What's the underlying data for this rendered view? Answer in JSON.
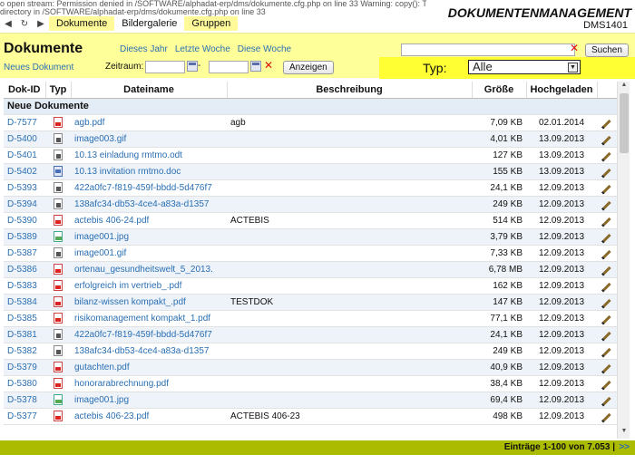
{
  "warning": {
    "line1": "o open stream: Permission denied in /SOFTWARE/alphadat-erp/dms/dokumente.cfg.php on line 33 Warning: copy(): The first argument to copy() function cannot be a",
    "line2": "directory in /SOFTWARE/alphadat-erp/dms/dokumente.cfg.php on line 33"
  },
  "app": {
    "title": "DOKUMENTENMANAGEMENT",
    "subtitle": "DMS1401"
  },
  "nav": {
    "back_icon": "arrow-left-icon",
    "reload_icon": "reload-icon",
    "forward_icon": "arrow-right-icon",
    "items": [
      "Dokumente",
      "Bildergalerie",
      "Gruppen"
    ]
  },
  "toolbar": {
    "title": "Dokumente",
    "new_doc": "Neues Dokument",
    "links": [
      "Dieses Jahr",
      "Letzte Woche",
      "Diese Woche"
    ],
    "range_label": "Zeitraum:",
    "range_sep": "-",
    "show_button": "Anzeigen",
    "search_value": "",
    "search_button": "Suchen",
    "type_label": "Typ:",
    "type_value": "Alle"
  },
  "table": {
    "headers": [
      "Dok-ID",
      "Typ",
      "Dateiname",
      "Beschreibung",
      "Größe",
      "Hochgeladen",
      ""
    ],
    "group": "Neue Dokumente",
    "rows": [
      {
        "id": "D-7577",
        "type": "pdf",
        "name": "agb.pdf",
        "desc": "agb",
        "size": "7,09 KB",
        "date": "02.01.2014"
      },
      {
        "id": "D-5400",
        "type": "gif",
        "name": "image003.gif",
        "desc": "",
        "size": "4,01 KB",
        "date": "13.09.2013"
      },
      {
        "id": "D-5401",
        "type": "odt",
        "name": "10.13 einladung rmtmo.odt",
        "desc": "",
        "size": "127 KB",
        "date": "13.09.2013"
      },
      {
        "id": "D-5402",
        "type": "doc",
        "name": "10.13 invitation rmtmo.doc",
        "desc": "",
        "size": "155 KB",
        "date": "13.09.2013"
      },
      {
        "id": "D-5393",
        "type": "gif",
        "name": "422a0fc7-f819-459f-bbdd-5d476f7",
        "desc": "",
        "size": "24,1 KB",
        "date": "12.09.2013"
      },
      {
        "id": "D-5394",
        "type": "gif",
        "name": "138afc34-db53-4ce4-a83a-d1357",
        "desc": "",
        "size": "249 KB",
        "date": "12.09.2013"
      },
      {
        "id": "D-5390",
        "type": "pdf",
        "name": "actebis 406-24.pdf",
        "desc": "ACTEBIS",
        "size": "514 KB",
        "date": "12.09.2013"
      },
      {
        "id": "D-5389",
        "type": "jpg",
        "name": "image001.jpg",
        "desc": "",
        "size": "3,79 KB",
        "date": "12.09.2013"
      },
      {
        "id": "D-5387",
        "type": "gif",
        "name": "image001.gif",
        "desc": "",
        "size": "7,33 KB",
        "date": "12.09.2013"
      },
      {
        "id": "D-5386",
        "type": "pdf",
        "name": "ortenau_gesundheitswelt_5_2013.",
        "desc": "",
        "size": "6,78 MB",
        "date": "12.09.2013"
      },
      {
        "id": "D-5383",
        "type": "pdf",
        "name": "erfolgreich im vertrieb_.pdf",
        "desc": "",
        "size": "162 KB",
        "date": "12.09.2013"
      },
      {
        "id": "D-5384",
        "type": "pdf",
        "name": "bilanz-wissen kompakt_.pdf",
        "desc": "TESTDOK",
        "size": "147 KB",
        "date": "12.09.2013"
      },
      {
        "id": "D-5385",
        "type": "pdf",
        "name": "risikomanagement kompakt_1.pdf",
        "desc": "",
        "size": "77,1 KB",
        "date": "12.09.2013"
      },
      {
        "id": "D-5381",
        "type": "gif",
        "name": "422a0fc7-f819-459f-bbdd-5d476f7",
        "desc": "",
        "size": "24,1 KB",
        "date": "12.09.2013"
      },
      {
        "id": "D-5382",
        "type": "gif",
        "name": "138afc34-db53-4ce4-a83a-d1357",
        "desc": "",
        "size": "249 KB",
        "date": "12.09.2013"
      },
      {
        "id": "D-5379",
        "type": "pdf",
        "name": "gutachten.pdf",
        "desc": "",
        "size": "40,9 KB",
        "date": "12.09.2013"
      },
      {
        "id": "D-5380",
        "type": "pdf",
        "name": "honorarabrechnung.pdf",
        "desc": "",
        "size": "38,4 KB",
        "date": "12.09.2013"
      },
      {
        "id": "D-5378",
        "type": "jpg",
        "name": "image001.jpg",
        "desc": "",
        "size": "69,4 KB",
        "date": "12.09.2013"
      },
      {
        "id": "D-5377",
        "type": "pdf",
        "name": "actebis 406-23.pdf",
        "desc": "ACTEBIS 406-23",
        "size": "498 KB",
        "date": "12.09.2013"
      }
    ]
  },
  "footer": {
    "entries": "Einträge 1-100 von 7.053 |",
    "next": ">>"
  }
}
